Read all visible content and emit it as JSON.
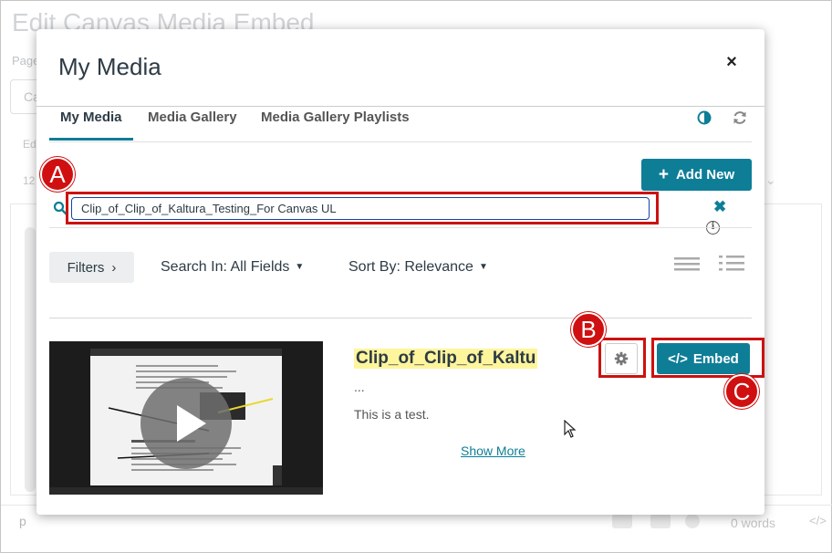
{
  "background": {
    "title": "Edit Canvas Media Embed",
    "page_label": "Page",
    "input_text": "Ca",
    "editor_label": "Ed",
    "size_text": "12",
    "footer_tag": "p",
    "word_count": "0 words",
    "code_toggle": "</>"
  },
  "modal": {
    "title": "My Media",
    "close_label": "×"
  },
  "tabs": [
    {
      "label": "My Media",
      "active": true
    },
    {
      "label": "Media Gallery",
      "active": false
    },
    {
      "label": "Media Gallery Playlists",
      "active": false
    }
  ],
  "toolbar": {
    "add_new_label": "Add New",
    "add_new_icon": "+",
    "contrast_icon": "contrast-icon",
    "refresh_icon": "refresh-icon"
  },
  "search": {
    "value": "Clip_of_Clip_of_Kaltura_Testing_For Canvas UL",
    "clear_label": "✖",
    "info_label": "i"
  },
  "filters": {
    "filters_label": "Filters",
    "search_in_label": "Search In: All Fields",
    "sort_by_label": "Sort By: Relevance"
  },
  "entry": {
    "title": "Clip_of_Clip_of_Kaltu",
    "ellipsis": "...",
    "description": "This is a test.",
    "show_more_label": "Show More",
    "embed_label": "Embed",
    "embed_icon": "</>"
  },
  "annotations": {
    "a": "A",
    "b": "B",
    "c": "C",
    "color": "#d01010"
  },
  "colors": {
    "accent": "#0e7e97",
    "highlight": "#fff59d"
  }
}
